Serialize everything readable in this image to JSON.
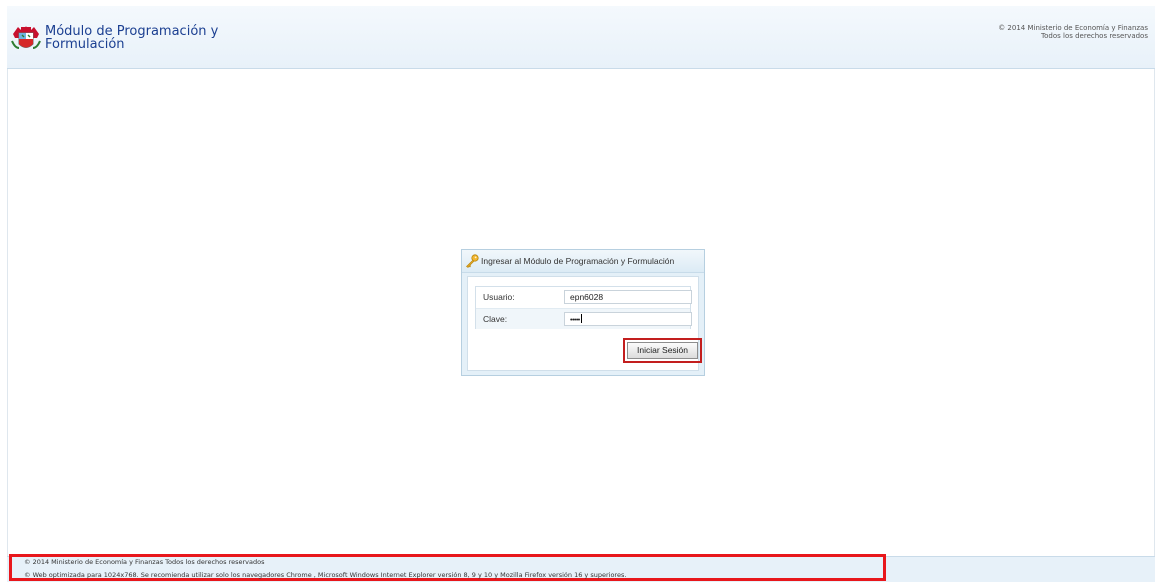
{
  "header": {
    "title_line1": "Módulo de Programación y",
    "title_line2": "Formulación",
    "copyright_line1": "© 2014 Ministerio de Economía y Finanzas",
    "copyright_line2": "Todos los derechos reservados",
    "logo_icon": "peru-coat-of-arms-icon"
  },
  "login": {
    "title": "Ingresar al Módulo de Programación y Formulación",
    "title_icon": "key-icon",
    "user_label": "Usuario:",
    "user_value": "epn6028",
    "password_label": "Clave:",
    "password_value": "•••••",
    "submit_label": "Iniciar Sesión"
  },
  "footer": {
    "line1": "© 2014 Ministerio de Economía y Finanzas Todos los derechos reservados",
    "line2": "© Web optimizada para 1024x768. Se recomienda utilizar solo los navegadores Chrome , Microsoft Windows Internet Explorer versión 8, 9 y 10 y Mozilla Firefox versión 16 y superiores."
  },
  "colors": {
    "title_blue": "#1b3f91",
    "highlight_red": "#e8171c",
    "header_bg": "#e8f1f9"
  }
}
